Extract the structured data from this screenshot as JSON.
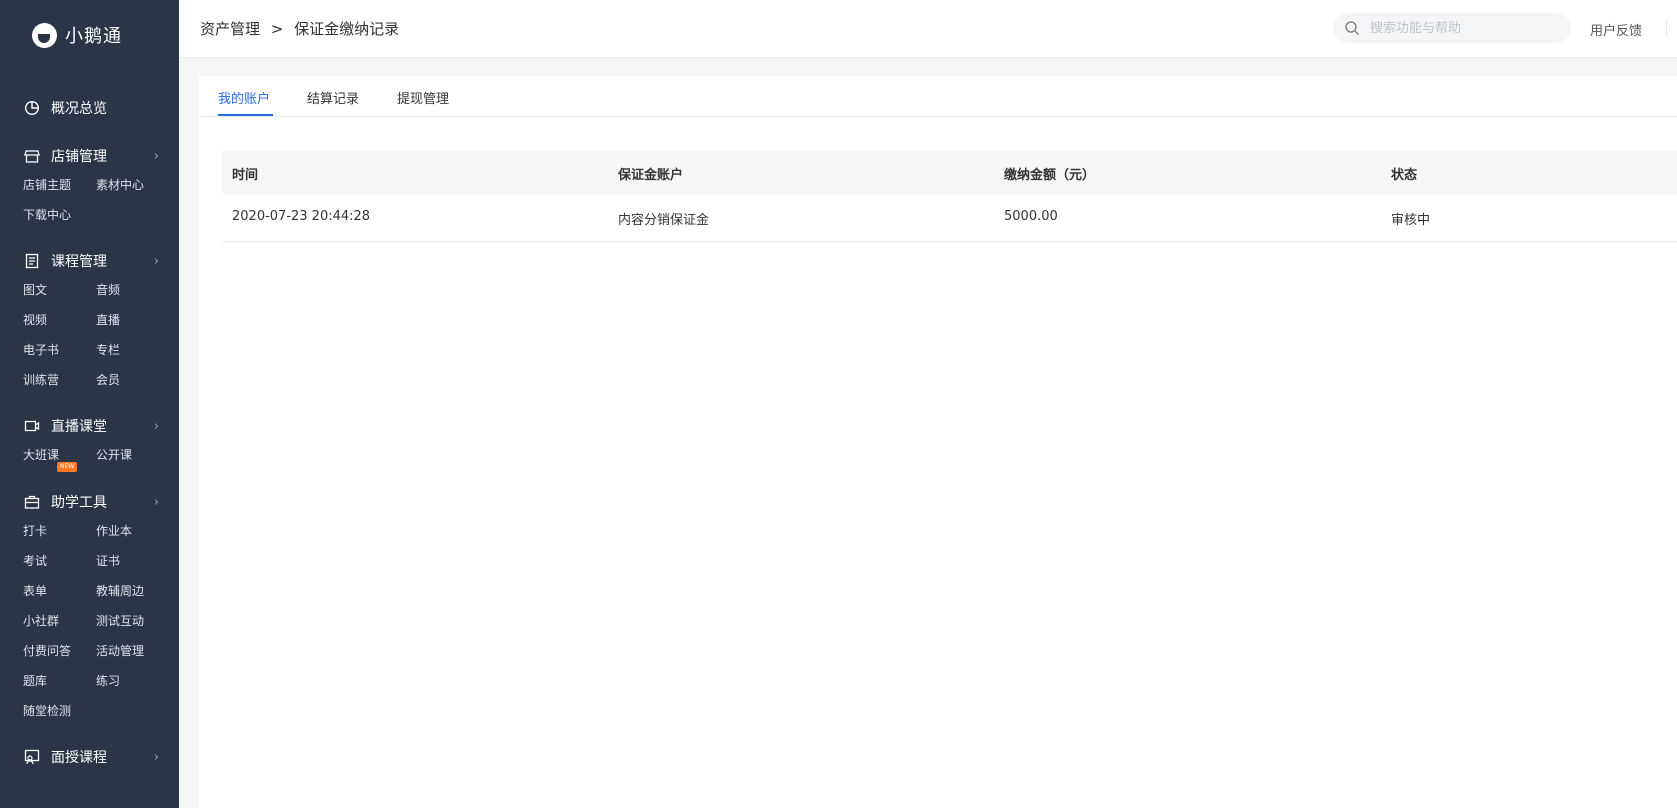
{
  "brand": {
    "name": "小鹅通"
  },
  "sidebar": {
    "overview": "概况总览",
    "groups": [
      {
        "label": "店铺管理",
        "items": [
          "店铺主题",
          "素材中心",
          "下载中心"
        ]
      },
      {
        "label": "课程管理",
        "items": [
          "图文",
          "音频",
          "视频",
          "直播",
          "电子书",
          "专栏",
          "训练营",
          "会员"
        ]
      },
      {
        "label": "直播课堂",
        "items": [
          "大班课",
          "公开课"
        ]
      },
      {
        "label": "助学工具",
        "items": [
          "打卡",
          "作业本",
          "考试",
          "证书",
          "表单",
          "教辅周边",
          "小社群",
          "测试互动",
          "付费问答",
          "活动管理",
          "题库",
          "练习",
          "随堂检测"
        ]
      },
      {
        "label": "面授课程",
        "items": []
      }
    ],
    "new_badge": "NEW"
  },
  "header": {
    "breadcrumb": [
      "资产管理",
      ">",
      "保证金缴纳记录"
    ],
    "search_placeholder": "搜索功能与帮助",
    "feedback": "用户反馈"
  },
  "tabs": [
    {
      "label": "我的账户",
      "active": true
    },
    {
      "label": "结算记录",
      "active": false
    },
    {
      "label": "提现管理",
      "active": false
    }
  ],
  "table": {
    "columns": [
      "时间",
      "保证金账户",
      "缴纳金额（元）",
      "状态"
    ],
    "rows": [
      [
        "2020-07-23 20:44:28",
        "内容分销保证金",
        "5000.00",
        "审核中"
      ]
    ]
  },
  "colors": {
    "sidebar_bg": "#2b3547",
    "accent": "#2a6ae8",
    "badge": "#ff7a22"
  }
}
